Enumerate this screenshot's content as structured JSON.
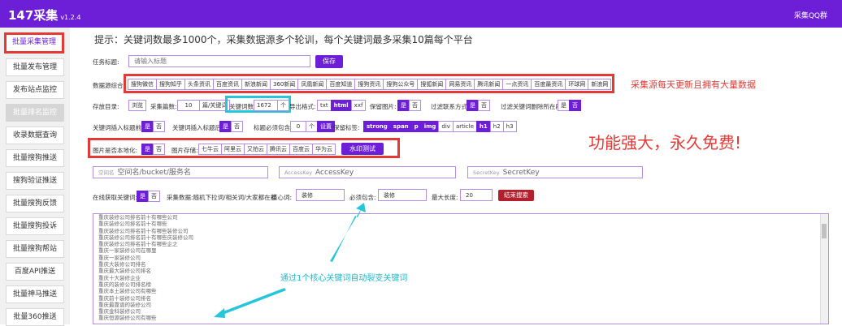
{
  "app": {
    "title": "147采集",
    "version": "v1.2.4",
    "qq_group": "采集QQ群"
  },
  "sidebar": {
    "items": [
      {
        "label": "批量采集管理"
      },
      {
        "label": "批量发布管理"
      },
      {
        "label": "发布站点监控"
      },
      {
        "label": "批量排名监控"
      },
      {
        "label": "收录数据查询"
      },
      {
        "label": "批量搜狗推送"
      },
      {
        "label": "搜狗验证推送"
      },
      {
        "label": "批量搜狗反馈"
      },
      {
        "label": "批量搜狗投诉"
      },
      {
        "label": "批量搜狗帮站"
      },
      {
        "label": "百度API推送"
      },
      {
        "label": "批量神马推送"
      },
      {
        "label": "批量360推送"
      }
    ]
  },
  "hint": "提示：关键词数最多1000个，采集数据源多个轮训，每个关键词最多采集10篇每个平台",
  "task": {
    "label": "任务标题:",
    "placeholder": "请输入标题",
    "save": "保存"
  },
  "sources": {
    "label": "数据源综合:",
    "items": [
      "搜狗微信",
      "搜狗知乎",
      "头条资讯",
      "百度资讯",
      "新浪新闻",
      "360新闻",
      "凤凰新闻",
      "百度知道",
      "搜狗资讯",
      "搜狗公众号",
      "搜狐新闻",
      "网易资讯",
      "腾讯新闻",
      "一点资讯",
      "百度最资讯",
      "环球网",
      "新浪网"
    ]
  },
  "row3": {
    "dir_label": "存放目录:",
    "dir_btn": "浏览",
    "count_label": "采集篇数:",
    "count_value": "10",
    "count_unit": "篇/关键词",
    "kw_label": "关键词数:",
    "kw_value": "1672",
    "kw_unit": "个",
    "export_label": "导出格式:",
    "formats": [
      "txt",
      "html",
      "xxf"
    ],
    "keep_img_label": "保留图片:",
    "yes": "是",
    "no": "否",
    "filter_contact_label": "过滤联系方式:",
    "filter_kw_label": "过滤关键词删除所在段:"
  },
  "row4": {
    "insert_title_label": "关键词插入标题前:",
    "insert_content_label": "关键词插入标题后:",
    "title_must_label": "标题必须包含:",
    "title_must_value": "0",
    "title_must_unit": "个",
    "set_btn": "设置",
    "keep_tag_label": "保留标签:",
    "tags": [
      "strong",
      "span",
      "p",
      "img",
      "div",
      "article",
      "h1",
      "h2",
      "h3"
    ]
  },
  "row5": {
    "local_label": "图片是否本地化:",
    "storage_label": "图片存储:",
    "storages": [
      "七牛云",
      "阿里云",
      "又拍云",
      "腾讯云",
      "百度云",
      "华为云"
    ],
    "watermark_btn": "水印测试"
  },
  "cloud": {
    "space": {
      "tag": "空间名",
      "placeholder": "空间名/bucket/服务名"
    },
    "ak": {
      "tag": "AccessKey",
      "placeholder": "AccessKey"
    },
    "sk": {
      "tag": "SecretKey",
      "placeholder": "SecretKey"
    }
  },
  "row7": {
    "online_label": "在线获取关键词:",
    "desc": "采集数据:随机下拉词/相关词/大家都在搜",
    "core_label": "核心词:",
    "core_value": "装修",
    "must_label": "必须包含:",
    "must_value": "装修",
    "max_label": "最大长度:",
    "max_value": "20",
    "stop_btn": "结束搜索"
  },
  "keywords": [
    "重庆装修公司排名前十有哪些公司",
    "重庆装修公司排名前十有哪些",
    "重庆装修公司排名前十有哪些装修公司",
    "重庆装修公司排名前十有哪些庆装修公司",
    "重庆装修公司排名前十有哪些企之",
    "重庆一家装修公司在哪里",
    "重庆一家装修公司",
    "重庆大装修公司排名",
    "重庆最大装修公司排名",
    "重庆十大装修企业",
    "重庆的装修公司排名榜",
    "重庆本土装修公司有哪些",
    "重庆前十装修公司排名",
    "重庆最靠谱的装修公司",
    "重庆金科装修公司",
    "重庆恒源装修公司有哪些"
  ],
  "annotations": {
    "source_note": "采集源每天更新且拥有大量数据",
    "power_note": "功能强大，永久免费!",
    "expand_note": "通过1个核心关键词自动裂变关键词"
  },
  "colors": {
    "accent": "#6d1fd8",
    "highlight_red": "#e53935",
    "highlight_cyan": "#26c6da",
    "stop_red": "#b21f2d"
  }
}
